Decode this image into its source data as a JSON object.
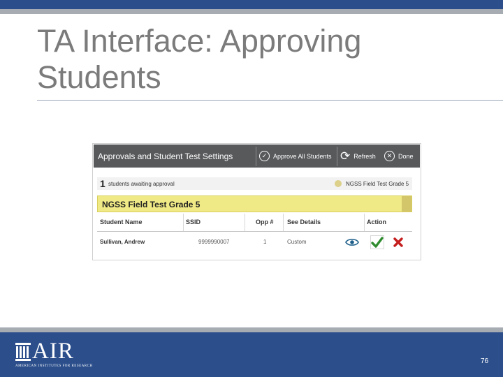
{
  "slide": {
    "title": "TA Interface: Approving Students",
    "page_number": "76"
  },
  "footer": {
    "logo_text": "AIR",
    "logo_subtitle": "AMERICAN INSTITUTES FOR RESEARCH"
  },
  "screenshot": {
    "header": {
      "title": "Approvals and Student Test Settings",
      "approve_all_label": "Approve All Students",
      "refresh_label": "Refresh",
      "done_label": "Done"
    },
    "awaiting": {
      "count": "1",
      "text": "students awaiting approval",
      "test_label": "NGSS Field Test Grade 5"
    },
    "group_title": "NGSS Field Test Grade 5",
    "columns": [
      "Student Name",
      "SSID",
      "Opp #",
      "See Details",
      "Action"
    ],
    "rows": [
      {
        "student_name": "Sullivan, Andrew",
        "ssid": "9999990007",
        "opp": "1",
        "details": "Custom"
      }
    ]
  },
  "colors": {
    "brand_blue": "#2c4f8c",
    "header_gray": "#58595b",
    "group_yellow": "#f0ea86",
    "accept_green": "#2e8b2e",
    "deny_red": "#c41e1e",
    "view_blue": "#1d5f8a"
  },
  "icons": {
    "approve_all": "check-circle-icon",
    "refresh": "refresh-icon",
    "done": "close-circle-icon",
    "view": "eye-icon",
    "accept": "checkmark-icon",
    "deny": "x-icon"
  }
}
